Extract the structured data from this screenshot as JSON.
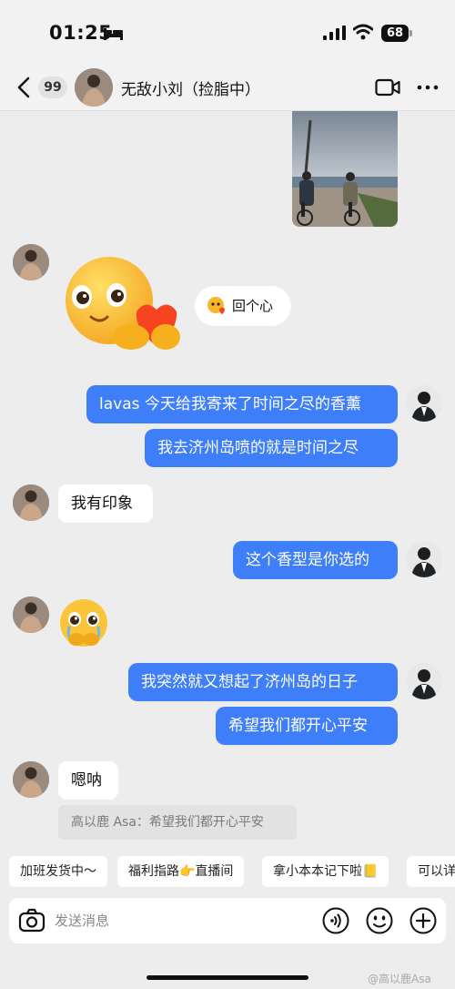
{
  "status_bar": {
    "time": "01:25",
    "battery": "68",
    "icons": [
      "bed-icon",
      "signal-icon",
      "wifi-icon",
      "battery-icon"
    ]
  },
  "nav": {
    "back_icon": "chevron-left-icon",
    "unread_count": "99",
    "contact_name": "无敌小刘（捡脂中）",
    "video_icon": "video-call-icon",
    "more_icon": "more-icon"
  },
  "messages": {
    "sticker_caption": "回个心",
    "self_1": "lavas 今天给我寄来了时间之尽的香薰",
    "self_2": "我去济州岛喷的就是时间之尽",
    "other_1": "我有印象",
    "self_3": "这个香型是你选的",
    "self_4": "我突然就又想起了济州岛的日子",
    "self_5": "希望我们都开心平安",
    "other_2": "嗯呐",
    "quote": "高以鹿 Asa：希望我们都开心平安"
  },
  "quick_replies": [
    "加班发货中～",
    "福利指路👉直播间",
    "拿小本本记下啦📒",
    "可以详"
  ],
  "input": {
    "placeholder": "发送消息",
    "icons": [
      "camera-icon",
      "voice-icon",
      "emoji-icon",
      "plus-icon"
    ]
  },
  "watermark": "@高以鹿Asa",
  "colors": {
    "self_bubble": "#3e7ef8",
    "other_bubble": "#ffffff",
    "background": "#ededed"
  }
}
